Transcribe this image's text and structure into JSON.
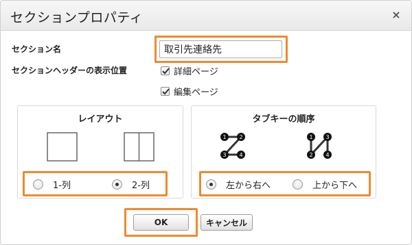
{
  "dialog": {
    "title": "セクションプロパティ",
    "close_glyph": "×"
  },
  "section_name": {
    "label": "セクション名",
    "value": "取引先連絡先"
  },
  "header_position": {
    "label": "セクションヘッダーの表示位置",
    "options": [
      {
        "label": "詳細ページ",
        "checked": true
      },
      {
        "label": "編集ページ",
        "checked": true
      }
    ]
  },
  "layout": {
    "title": "レイアウト",
    "options": [
      {
        "label": "1-列",
        "selected": false,
        "icon": "one-column-icon"
      },
      {
        "label": "2-列",
        "selected": true,
        "icon": "two-column-icon"
      }
    ]
  },
  "tab_order": {
    "title": "タブキーの順序",
    "options": [
      {
        "label": "左から右へ",
        "selected": true,
        "icon": "left-to-right-order-icon"
      },
      {
        "label": "上から下へ",
        "selected": false,
        "icon": "top-to-bottom-order-icon"
      }
    ],
    "node_numbers": [
      "1",
      "2",
      "3",
      "4"
    ]
  },
  "buttons": {
    "ok": "OK",
    "cancel": "キャンセル"
  },
  "colors": {
    "highlight": "#f0892e"
  }
}
